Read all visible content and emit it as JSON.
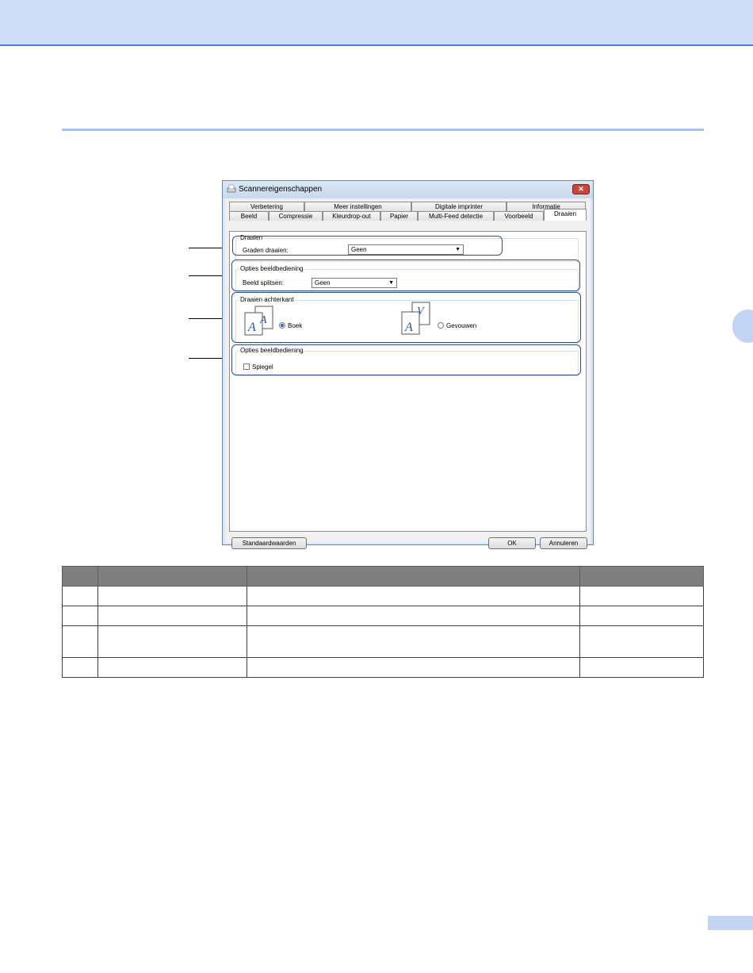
{
  "dialog": {
    "title": "Scannereigenschappen",
    "close_label": "✕",
    "tabs_back": [
      "Verbetering",
      "Meer instellingen",
      "Digitale imprinter",
      "Informatie"
    ],
    "tabs_front": [
      "Beeld",
      "Compressie",
      "Kleurdrop-out",
      "Papier",
      "Multi-Feed detectie",
      "Voorbeeld",
      "Draaien"
    ],
    "active_tab": "Draaien",
    "groups": {
      "rotate": {
        "title": "Draaien",
        "label": "Graden draaien:",
        "value": "Geen"
      },
      "image_options_1": {
        "title": "Opties beeldbediening",
        "label": "Beeld splitsen:",
        "value": "Geen"
      },
      "rotate_back": {
        "title": "Draaien achterkant",
        "option_book": "Boek",
        "option_fold": "Gevouwen"
      },
      "image_options_2": {
        "title": "Opties beeldbediening",
        "mirror_label": "Spiegel"
      }
    },
    "buttons": {
      "defaults": "Standaardwaarden",
      "ok": "OK",
      "cancel": "Annuleren"
    },
    "accent": "#2d4d8a"
  },
  "table": {
    "header_color": "#7f7f7f",
    "rows": 4
  }
}
